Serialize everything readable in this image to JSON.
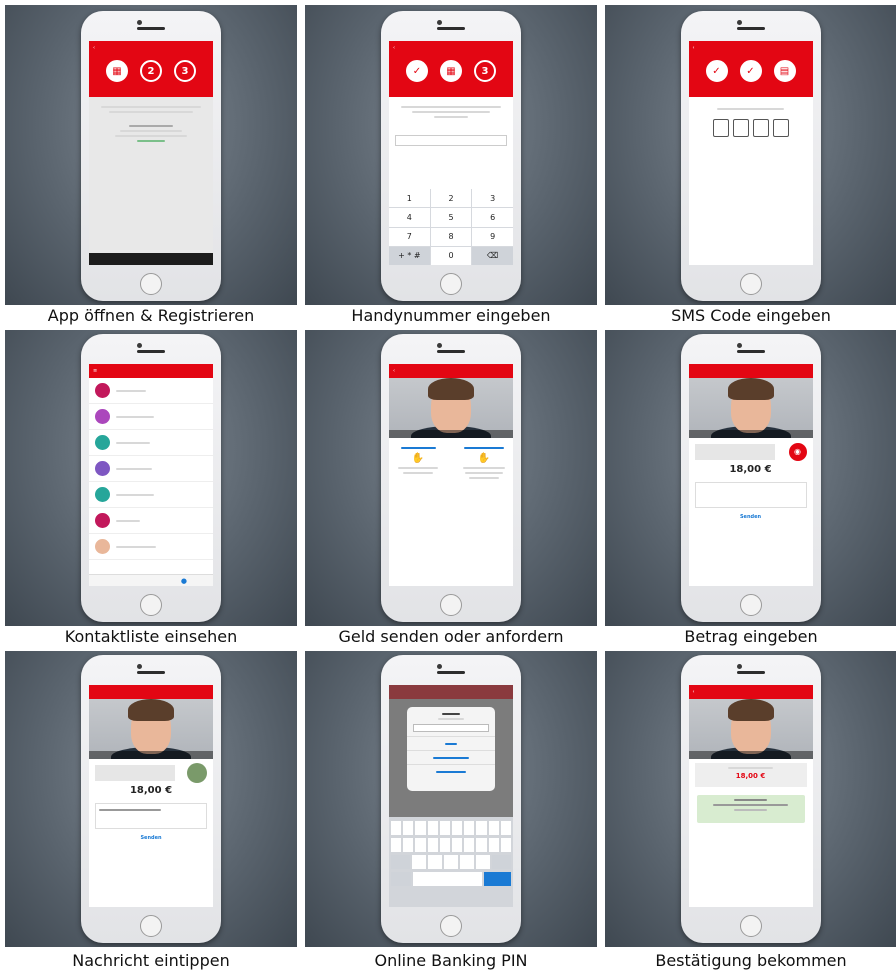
{
  "captions": [
    "App öffnen & Registrieren",
    "Handynummer eingeben",
    "SMS Code eingeben",
    "Kontaktliste einsehen",
    "Geld senden oder anfordern",
    "Betrag eingeben",
    "Nachricht eintippen",
    "Online Banking PIN",
    "Bestätigung bekommen"
  ],
  "screen1": {
    "steps": [
      "",
      "2",
      "3"
    ]
  },
  "screen2": {
    "steps": [
      "",
      "",
      "3"
    ],
    "keys": [
      "1",
      "2",
      "3",
      "4",
      "5",
      "6",
      "7",
      "8",
      "9",
      "+ * #",
      "0",
      "⌫"
    ]
  },
  "screen4": {
    "contact_colors": [
      "#c2185b",
      "#ab47bc",
      "#26a69a",
      "#7e57c2",
      "#26a69a",
      "#c2185b"
    ]
  },
  "screen6": {
    "amount": "18,00 €",
    "send": "Senden"
  },
  "screen7": {
    "amount": "18,00 €",
    "send": "Senden"
  },
  "screen9": {
    "amount": "18,00 €"
  },
  "colors": {
    "brand_red": "#e30613",
    "link_blue": "#1a7ad4"
  }
}
